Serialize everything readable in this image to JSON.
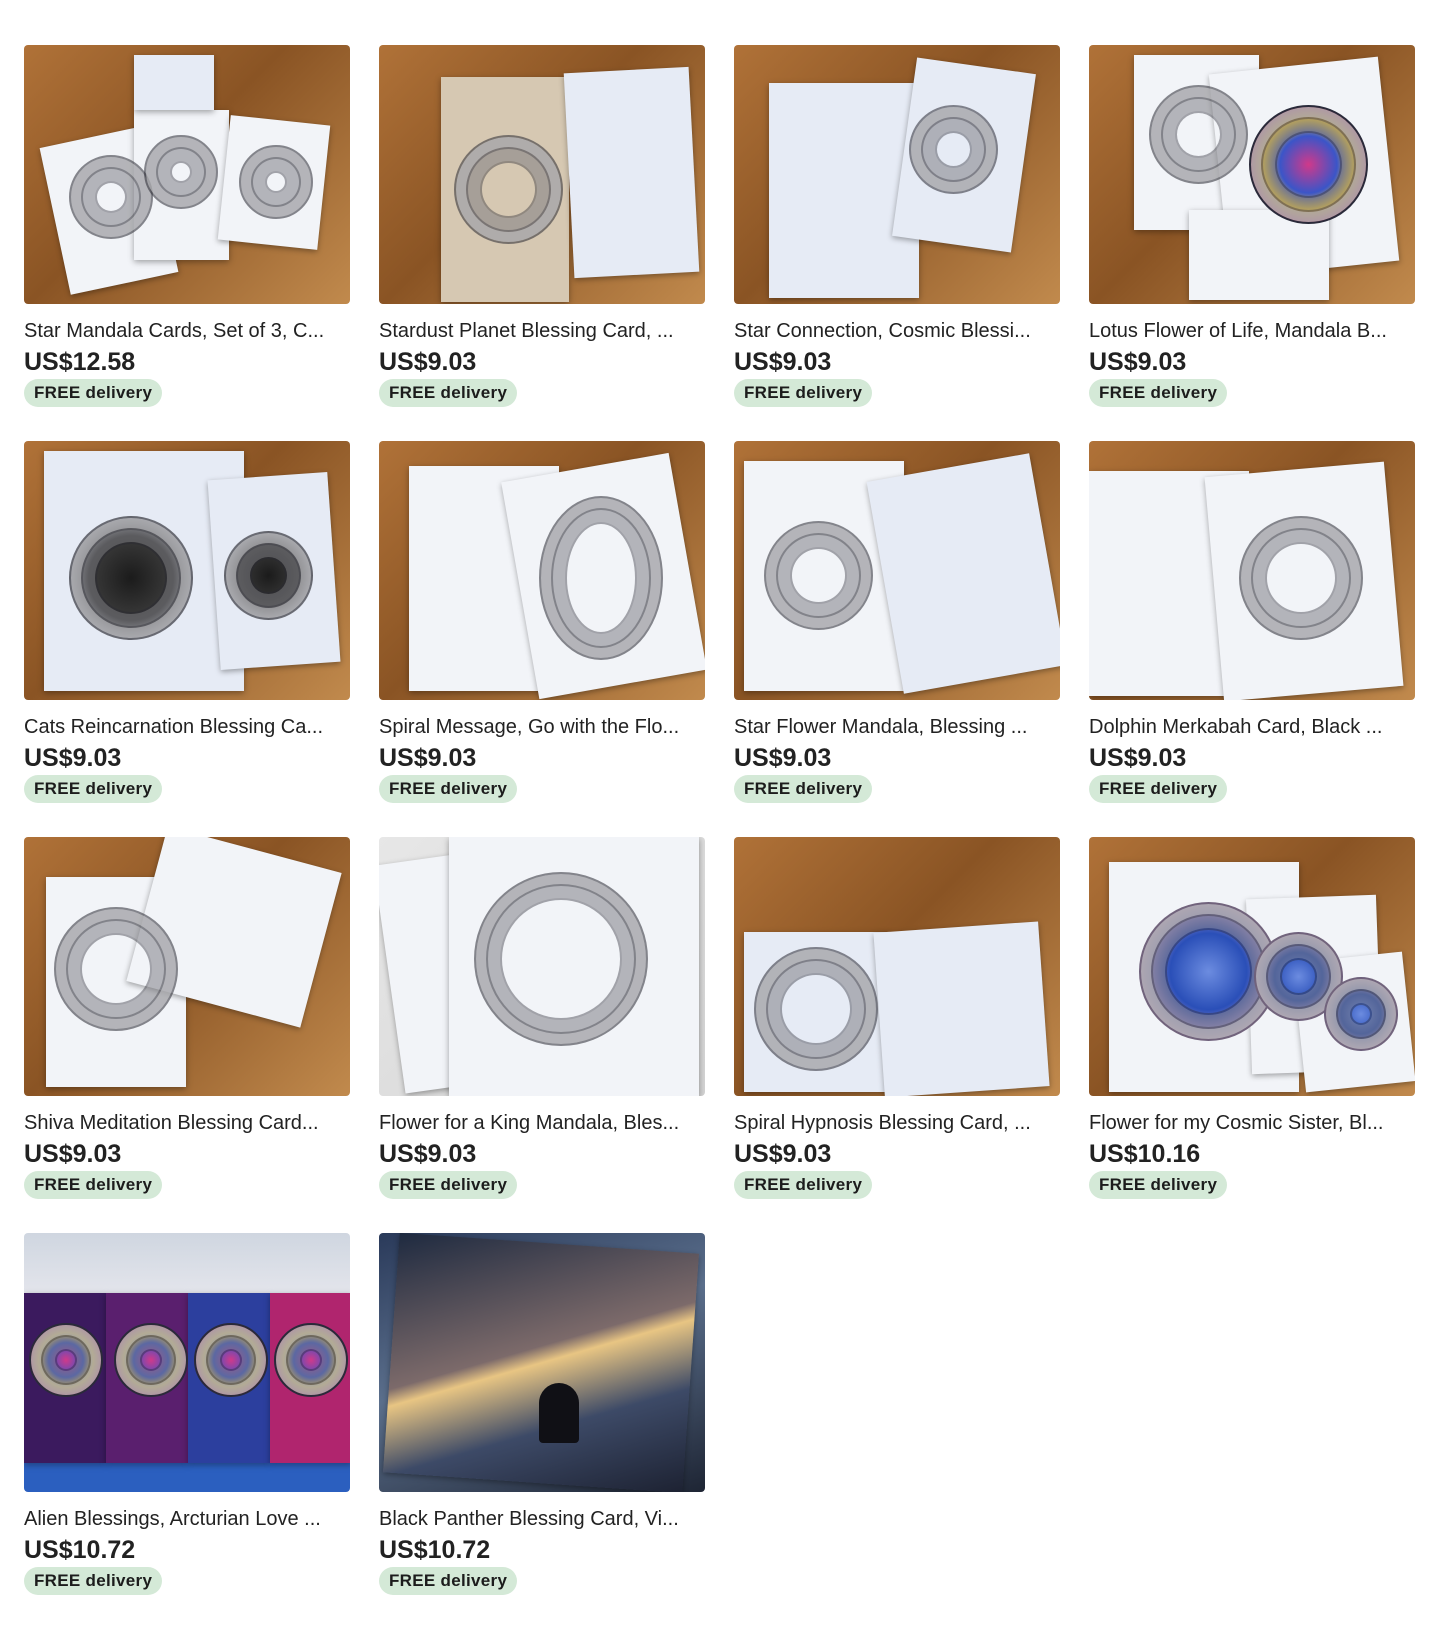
{
  "listings": [
    {
      "title": "Star Mandala Cards, Set of 3, C...",
      "price": "US$12.58",
      "badge": "FREE delivery"
    },
    {
      "title": "Stardust Planet Blessing Card, ...",
      "price": "US$9.03",
      "badge": "FREE delivery"
    },
    {
      "title": "Star Connection, Cosmic Blessi...",
      "price": "US$9.03",
      "badge": "FREE delivery"
    },
    {
      "title": "Lotus Flower of Life, Mandala B...",
      "price": "US$9.03",
      "badge": "FREE delivery"
    },
    {
      "title": "Cats Reincarnation Blessing Ca...",
      "price": "US$9.03",
      "badge": "FREE delivery"
    },
    {
      "title": "Spiral Message, Go with the Flo...",
      "price": "US$9.03",
      "badge": "FREE delivery"
    },
    {
      "title": "Star Flower Mandala, Blessing ...",
      "price": "US$9.03",
      "badge": "FREE delivery"
    },
    {
      "title": "Dolphin Merkabah Card, Black ...",
      "price": "US$9.03",
      "badge": "FREE delivery"
    },
    {
      "title": "Shiva Meditation Blessing Card...",
      "price": "US$9.03",
      "badge": "FREE delivery"
    },
    {
      "title": "Flower for a King Mandala, Bles...",
      "price": "US$9.03",
      "badge": "FREE delivery"
    },
    {
      "title": "Spiral Hypnosis Blessing Card, ...",
      "price": "US$9.03",
      "badge": "FREE delivery"
    },
    {
      "title": "Flower for my Cosmic Sister, Bl...",
      "price": "US$10.16",
      "badge": "FREE delivery"
    },
    {
      "title": "Alien Blessings, Arcturian Love ...",
      "price": "US$10.72",
      "badge": "FREE delivery"
    },
    {
      "title": "Black Panther Blessing Card, Vi...",
      "price": "US$10.72",
      "badge": "FREE delivery"
    }
  ],
  "colors": {
    "badge_bg": "#d4e9d7",
    "text": "#222222"
  }
}
